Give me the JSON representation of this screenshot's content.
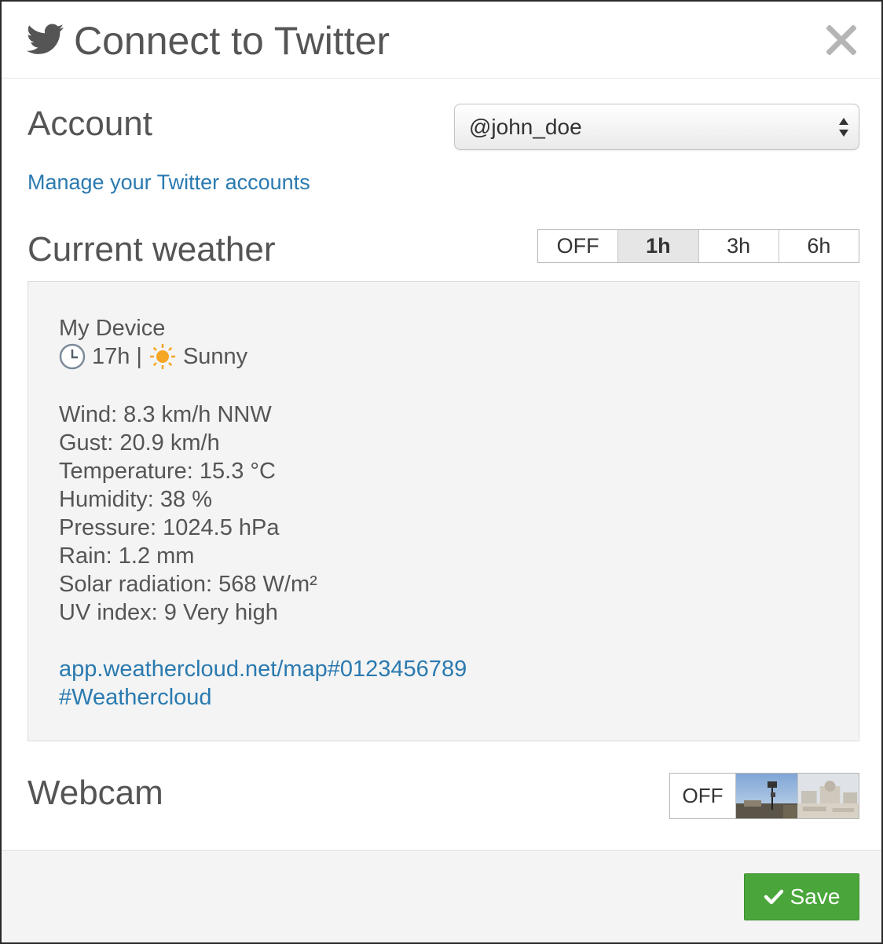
{
  "header": {
    "title": "Connect to Twitter",
    "icon": "twitter-bird-icon",
    "close_icon": "close-icon"
  },
  "account": {
    "section_title": "Account",
    "selected": "@john_doe",
    "manage_link": "Manage your Twitter accounts"
  },
  "weather": {
    "section_title": "Current weather",
    "intervals": [
      "OFF",
      "1h",
      "3h",
      "6h"
    ],
    "selected_interval": "1h",
    "preview": {
      "device": "My Device",
      "time": "17h",
      "separator": "|",
      "condition": "Sunny",
      "lines": [
        "Wind: 8.3 km/h NNW",
        "Gust: 20.9 km/h",
        "Temperature: 15.3 °C",
        "Humidity: 38 %",
        "Pressure: 1024.5 hPa",
        "Rain: 1.2 mm",
        "Solar radiation: 568 W/m²",
        "UV index: 9 Very high"
      ],
      "url": "app.weathercloud.net/map#0123456789",
      "hashtag": "#Weathercloud"
    }
  },
  "webcam": {
    "section_title": "Webcam",
    "off_label": "OFF"
  },
  "footer": {
    "save_label": "Save"
  },
  "colors": {
    "link": "#2a7ab0",
    "save_button": "#4aa63b",
    "panel_bg": "#f4f4f4",
    "sun": "#f5a623"
  }
}
